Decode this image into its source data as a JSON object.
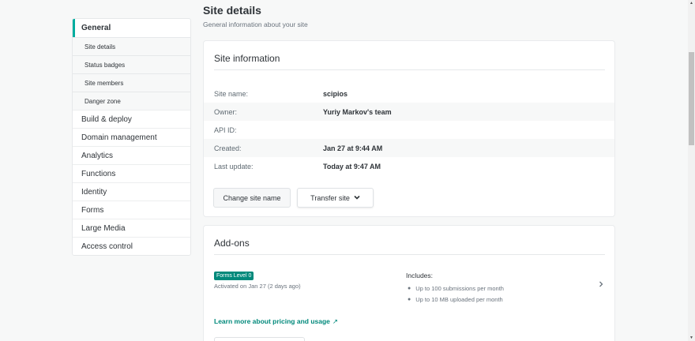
{
  "sidebar": {
    "general": "General",
    "sub_items": [
      "Site details",
      "Status badges",
      "Site members",
      "Danger zone"
    ],
    "items": [
      "Build & deploy",
      "Domain management",
      "Analytics",
      "Functions",
      "Identity",
      "Forms",
      "Large Media",
      "Access control"
    ]
  },
  "header": {
    "title": "Site details",
    "subtitle": "General information about your site"
  },
  "site_info": {
    "title": "Site information",
    "rows": [
      {
        "label": "Site name:",
        "value": "scipios"
      },
      {
        "label": "Owner:",
        "value": "Yuriy Markov's team"
      },
      {
        "label": "API ID:",
        "value": ""
      },
      {
        "label": "Created:",
        "value": "Jan 27 at 9:44 AM"
      },
      {
        "label": "Last update:",
        "value": "Today at 9:47 AM"
      }
    ],
    "change_name_label": "Change site name",
    "transfer_label": "Transfer site",
    "transfer_icon": "chevron-down-icon"
  },
  "addons": {
    "title": "Add-ons",
    "badge": "Forms Level 0",
    "activated": "Activated on Jan 27 (2 days ago)",
    "includes_title": "Includes:",
    "includes": [
      "Up to 100 submissions per month",
      "Up to 10 MB uploaded per month"
    ],
    "learn_more": "Learn more about pricing and usage",
    "learn_icon": "external-link-icon",
    "arrow_icon": "chevron-right-icon"
  },
  "colors": {
    "accent": "#00ad9f",
    "badge": "#00897b",
    "background": "#f7f8f8"
  }
}
